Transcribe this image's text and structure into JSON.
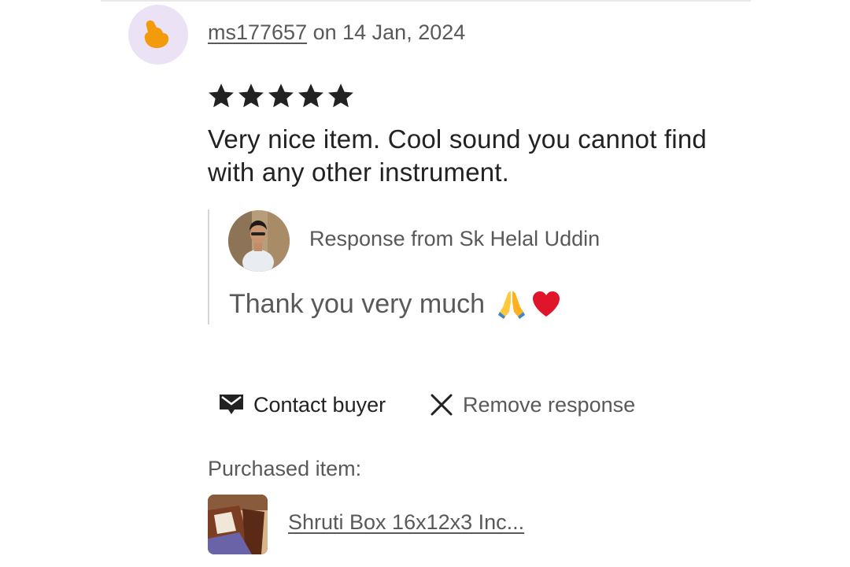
{
  "review": {
    "username": "ms177657",
    "date_text": " on 14 Jan, 2024",
    "rating": 5,
    "text": "Very nice item. Cool sound you cannot find with any other instrument.",
    "avatar_icon": "hand-icon",
    "avatar_bg": "#ece2f6",
    "avatar_fg": "#f29b0c"
  },
  "response": {
    "from_label": "Response from Sk Helal Uddin",
    "text": "Thank you very much",
    "emojis": [
      "folded-hands-icon",
      "red-heart-icon"
    ]
  },
  "actions": {
    "contact_label": "Contact buyer",
    "contact_icon": "message-icon",
    "remove_label": "Remove response",
    "remove_icon": "close-icon"
  },
  "purchase": {
    "label": "Purchased item:",
    "item_title": "Shruti Box 16x12x3 Inc..."
  }
}
